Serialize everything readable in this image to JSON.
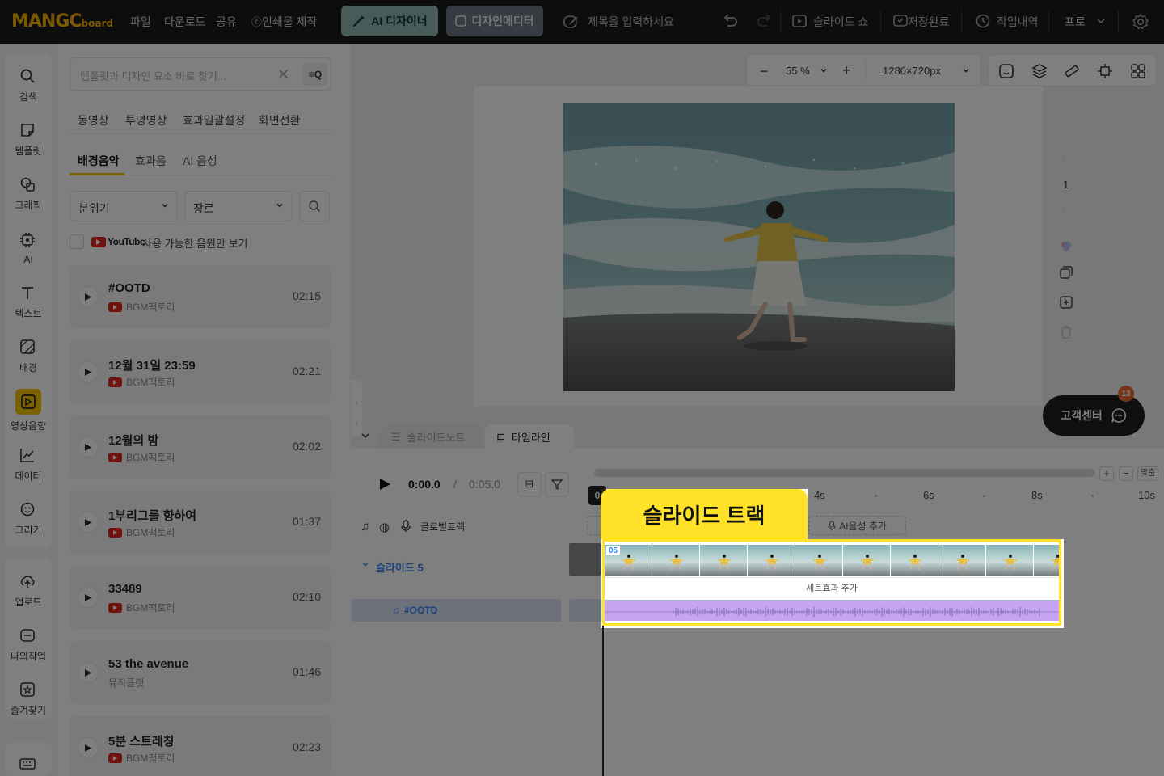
{
  "app": {
    "logo_main": "MANGC",
    "logo_sub": "board",
    "menu": [
      "파일",
      "다운로드",
      "공유",
      "인쇄물 제작"
    ],
    "ai_designer": "AI 디자이너",
    "design_editor": "디자인에디터",
    "title_placeholder": "제목을 입력하세요",
    "slideshow": "슬라이드 쇼",
    "save_status": "저장완료",
    "history": "작업내역",
    "plan": "프로"
  },
  "rail": [
    {
      "id": "search",
      "label": "검색",
      "icon": "search-icon"
    },
    {
      "id": "template",
      "label": "템플릿",
      "icon": "template-icon"
    },
    {
      "id": "graphic",
      "label": "그래픽",
      "icon": "graphic-icon"
    },
    {
      "id": "ai",
      "label": "AI",
      "icon": "ai-chip-icon"
    },
    {
      "id": "text",
      "label": "텍스트",
      "icon": "text-icon"
    },
    {
      "id": "background",
      "label": "배경",
      "icon": "background-icon"
    },
    {
      "id": "media",
      "label": "영상음향",
      "icon": "media-icon",
      "active": true
    },
    {
      "id": "data",
      "label": "데이터",
      "icon": "chart-icon"
    },
    {
      "id": "draw",
      "label": "그리기",
      "icon": "draw-icon"
    },
    {
      "id": "upload",
      "label": "업로드",
      "icon": "upload-icon"
    },
    {
      "id": "mywork",
      "label": "나의작업",
      "icon": "folder-icon"
    },
    {
      "id": "favorites",
      "label": "즐겨찾기",
      "icon": "star-icon"
    }
  ],
  "panel": {
    "search_placeholder": "템플릿과 디자인 요소 바로 찾기...",
    "search_btn": "≡Q",
    "tabs_row1": [
      "동영상",
      "투명영상",
      "효과일괄설정",
      "화면전환"
    ],
    "tabs_row2": [
      "배경음악",
      "효과음",
      "AI 음성"
    ],
    "filter_mood": "분위기",
    "filter_genre": "장르",
    "youtube_wordmark": "YouTube",
    "youtube_only": "사용 가능한 음원만 보기",
    "tracks": [
      {
        "title": "#OOTD",
        "source": "BGM팩토리",
        "duration": "02:15",
        "yt": true
      },
      {
        "title": "12월 31일 23:59",
        "source": "BGM팩토리",
        "duration": "02:21",
        "yt": true
      },
      {
        "title": "12월의 밤",
        "source": "BGM팩토리",
        "duration": "02:02",
        "yt": true
      },
      {
        "title": "1부리그를 향하여",
        "source": "BGM팩토리",
        "duration": "01:37",
        "yt": true
      },
      {
        "title": "33489",
        "source": "BGM팩토리",
        "duration": "02:10",
        "yt": true
      },
      {
        "title": "53 the avenue",
        "source": "뮤직플랫",
        "duration": "01:46",
        "yt": false
      },
      {
        "title": "5분 스트레칭",
        "source": "BGM팩토리",
        "duration": "02:23",
        "yt": true
      }
    ]
  },
  "editor": {
    "zoom": "55 %",
    "canvas_size": "1280×720px",
    "page_number": "1",
    "help": "고객센터",
    "help_badge": "13"
  },
  "timeline": {
    "tab_notes": "슬라이드노트",
    "tab_timeline": "타임라인",
    "current_time": "0:00.0",
    "separator": "/",
    "total_time": "0:05.0",
    "fit": "맞춤",
    "ticks": [
      "4s",
      "6s",
      "8s",
      "10s"
    ],
    "playhead_label": "0",
    "global_track": "글로벌트랙",
    "ai_voice_add": "AI음성 추가",
    "slide_label": "슬라이드 5",
    "slide_number": "05",
    "effect_add": "세트효과 추가",
    "audio_track": "#OOTD",
    "highlight_label": "슬라이드 트랙"
  },
  "colors": {
    "accent": "#f5c400",
    "highlight": "#ffe229",
    "youtube": "#e0241b",
    "audio_clip": "#c4a5ee"
  }
}
